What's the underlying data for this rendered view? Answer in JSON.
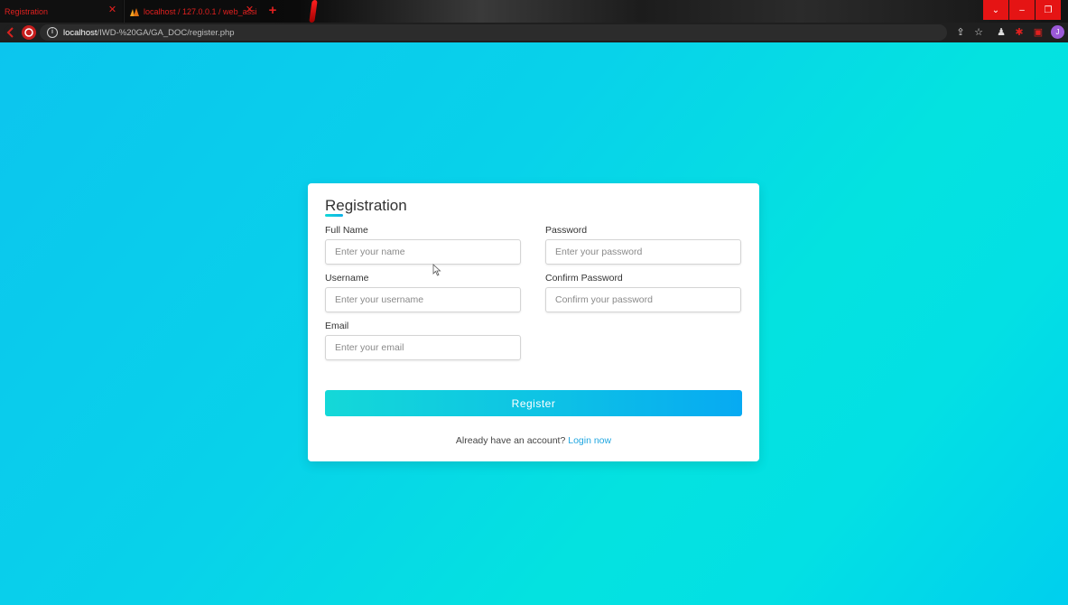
{
  "browser": {
    "tabs": [
      {
        "label": "Registration"
      },
      {
        "label": "localhost / 127.0.0.1 / web_assi"
      }
    ],
    "new_tab": "+",
    "window_controls": [
      "⌄",
      "–",
      "❐"
    ],
    "url_host": "localhost",
    "url_path": "/IWD-%20GA/GA_DOC/register.php",
    "info_icon": "i",
    "profile_initial": "J",
    "accent_color": "#e0201f"
  },
  "form": {
    "title": "Registration",
    "fields": {
      "full_name": {
        "label": "Full Name",
        "placeholder": "Enter your name"
      },
      "username": {
        "label": "Username",
        "placeholder": "Enter your username"
      },
      "email": {
        "label": "Email",
        "placeholder": "Enter your email"
      },
      "password": {
        "label": "Password",
        "placeholder": "Enter your password"
      },
      "confirm_password": {
        "label": "Confirm Password",
        "placeholder": "Confirm your password"
      }
    },
    "submit_label": "Register",
    "footer_text": "Already have an account?",
    "login_link": "Login now"
  },
  "theme": {
    "background_gradient": [
      "#0cc5ee",
      "#04e2e0"
    ],
    "button_gradient": [
      "#14d8d8",
      "#07aaf2"
    ],
    "link_color": "#1fa6e0"
  }
}
